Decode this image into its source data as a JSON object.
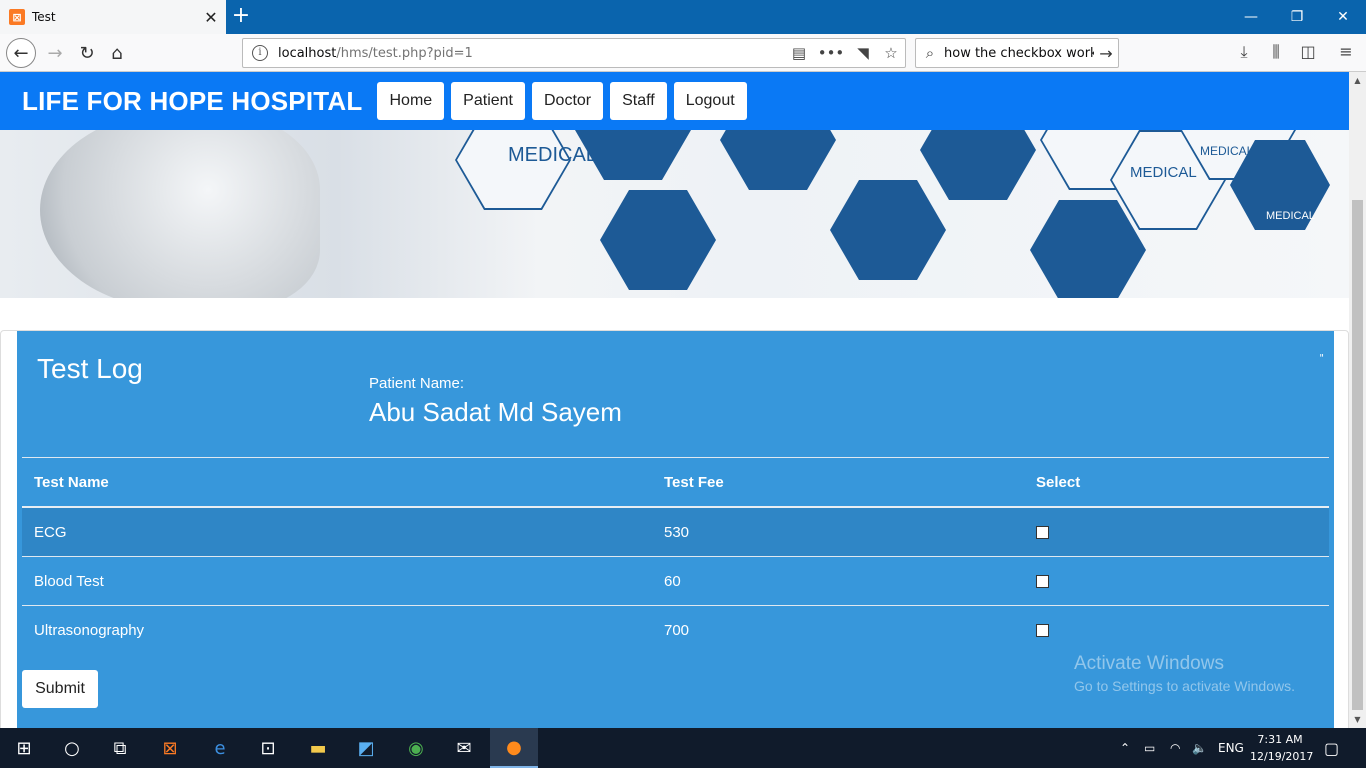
{
  "browser": {
    "tab_title": "Test",
    "tab_favicon": "xampp-icon",
    "url_host": "localhost",
    "url_path": "/hms/test.php?pid=1",
    "search_text": "how the checkbox work",
    "window_buttons": [
      "minimize",
      "restore",
      "close"
    ]
  },
  "site": {
    "brand": "LIFE FOR HOPE HOSPITAL",
    "nav": [
      "Home",
      "Patient",
      "Doctor",
      "Staff",
      "Logout"
    ],
    "banner_labels": [
      "MEDICAL",
      "MEDICAL",
      "MEDICAL",
      "MEDICAL"
    ],
    "banner_colors": {
      "hex_blue": "#1d5a96",
      "nav_blue": "#0a79f5"
    }
  },
  "card": {
    "title": "Test Log",
    "patient_label": "Patient Name:",
    "patient_name": "Abu Sadat Md Sayem",
    "corner_mark": "\"",
    "bg_color": "#3797db",
    "table": {
      "headers": [
        "Test Name",
        "Test Fee",
        "Select"
      ],
      "rows": [
        {
          "name": "ECG",
          "fee": "530",
          "selected": false
        },
        {
          "name": "Blood Test",
          "fee": "60",
          "selected": false
        },
        {
          "name": "Ultrasonography",
          "fee": "700",
          "selected": false
        }
      ]
    },
    "submit_label": "Submit"
  },
  "watermark": {
    "line1": "Activate Windows",
    "line2": "Go to Settings to activate Windows."
  },
  "taskbar": {
    "apps": [
      "windows-start-icon",
      "cortana-icon",
      "task-view-icon",
      "xampp-icon",
      "edge-icon",
      "store-icon",
      "file-explorer-icon",
      "network-computer-icon",
      "chrome-icon",
      "mail-icon",
      "firefox-icon"
    ],
    "language": "ENG",
    "time": "7:31 AM",
    "date": "12/19/2017"
  }
}
